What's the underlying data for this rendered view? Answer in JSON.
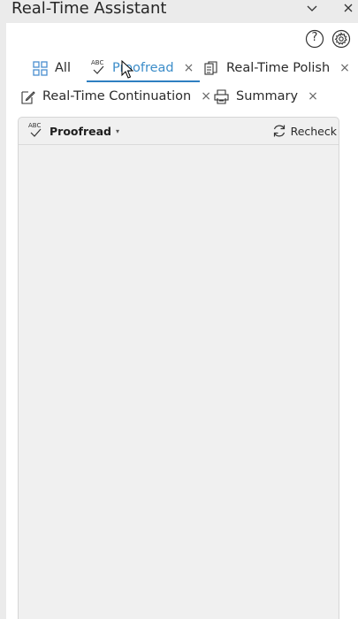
{
  "window": {
    "title": "Real-Time Assistant",
    "chevron_icon": "chevron-down-icon",
    "close_icon": "close-icon"
  },
  "toolbar": {
    "help_icon": "help-icon",
    "settings_icon": "gear-icon",
    "help_glyph": "?"
  },
  "tabs": [
    {
      "label": "All",
      "icon": "grid-icon",
      "closable": false,
      "active": false
    },
    {
      "label": "Proofread",
      "icon": "abc-check-icon",
      "closable": true,
      "active": true
    },
    {
      "label": "Real-Time Polish",
      "icon": "document-copy-icon",
      "closable": true,
      "active": false
    },
    {
      "label": "Real-Time Continuation",
      "icon": "edit-document-icon",
      "closable": true,
      "active": false
    },
    {
      "label": "Summary",
      "icon": "printer-summary-icon",
      "closable": true,
      "active": false
    }
  ],
  "tab_close_glyph": "×",
  "panel": {
    "mode_label": "Proofread",
    "mode_caret": "▾",
    "abc_glyph": "ABC",
    "recheck_label": "Recheck"
  },
  "colors": {
    "accent": "#2e7fc1",
    "active_tab_text": "#3c8dc9",
    "panel_bg": "#f0f0f0",
    "chrome_bg": "#ebebeb"
  }
}
